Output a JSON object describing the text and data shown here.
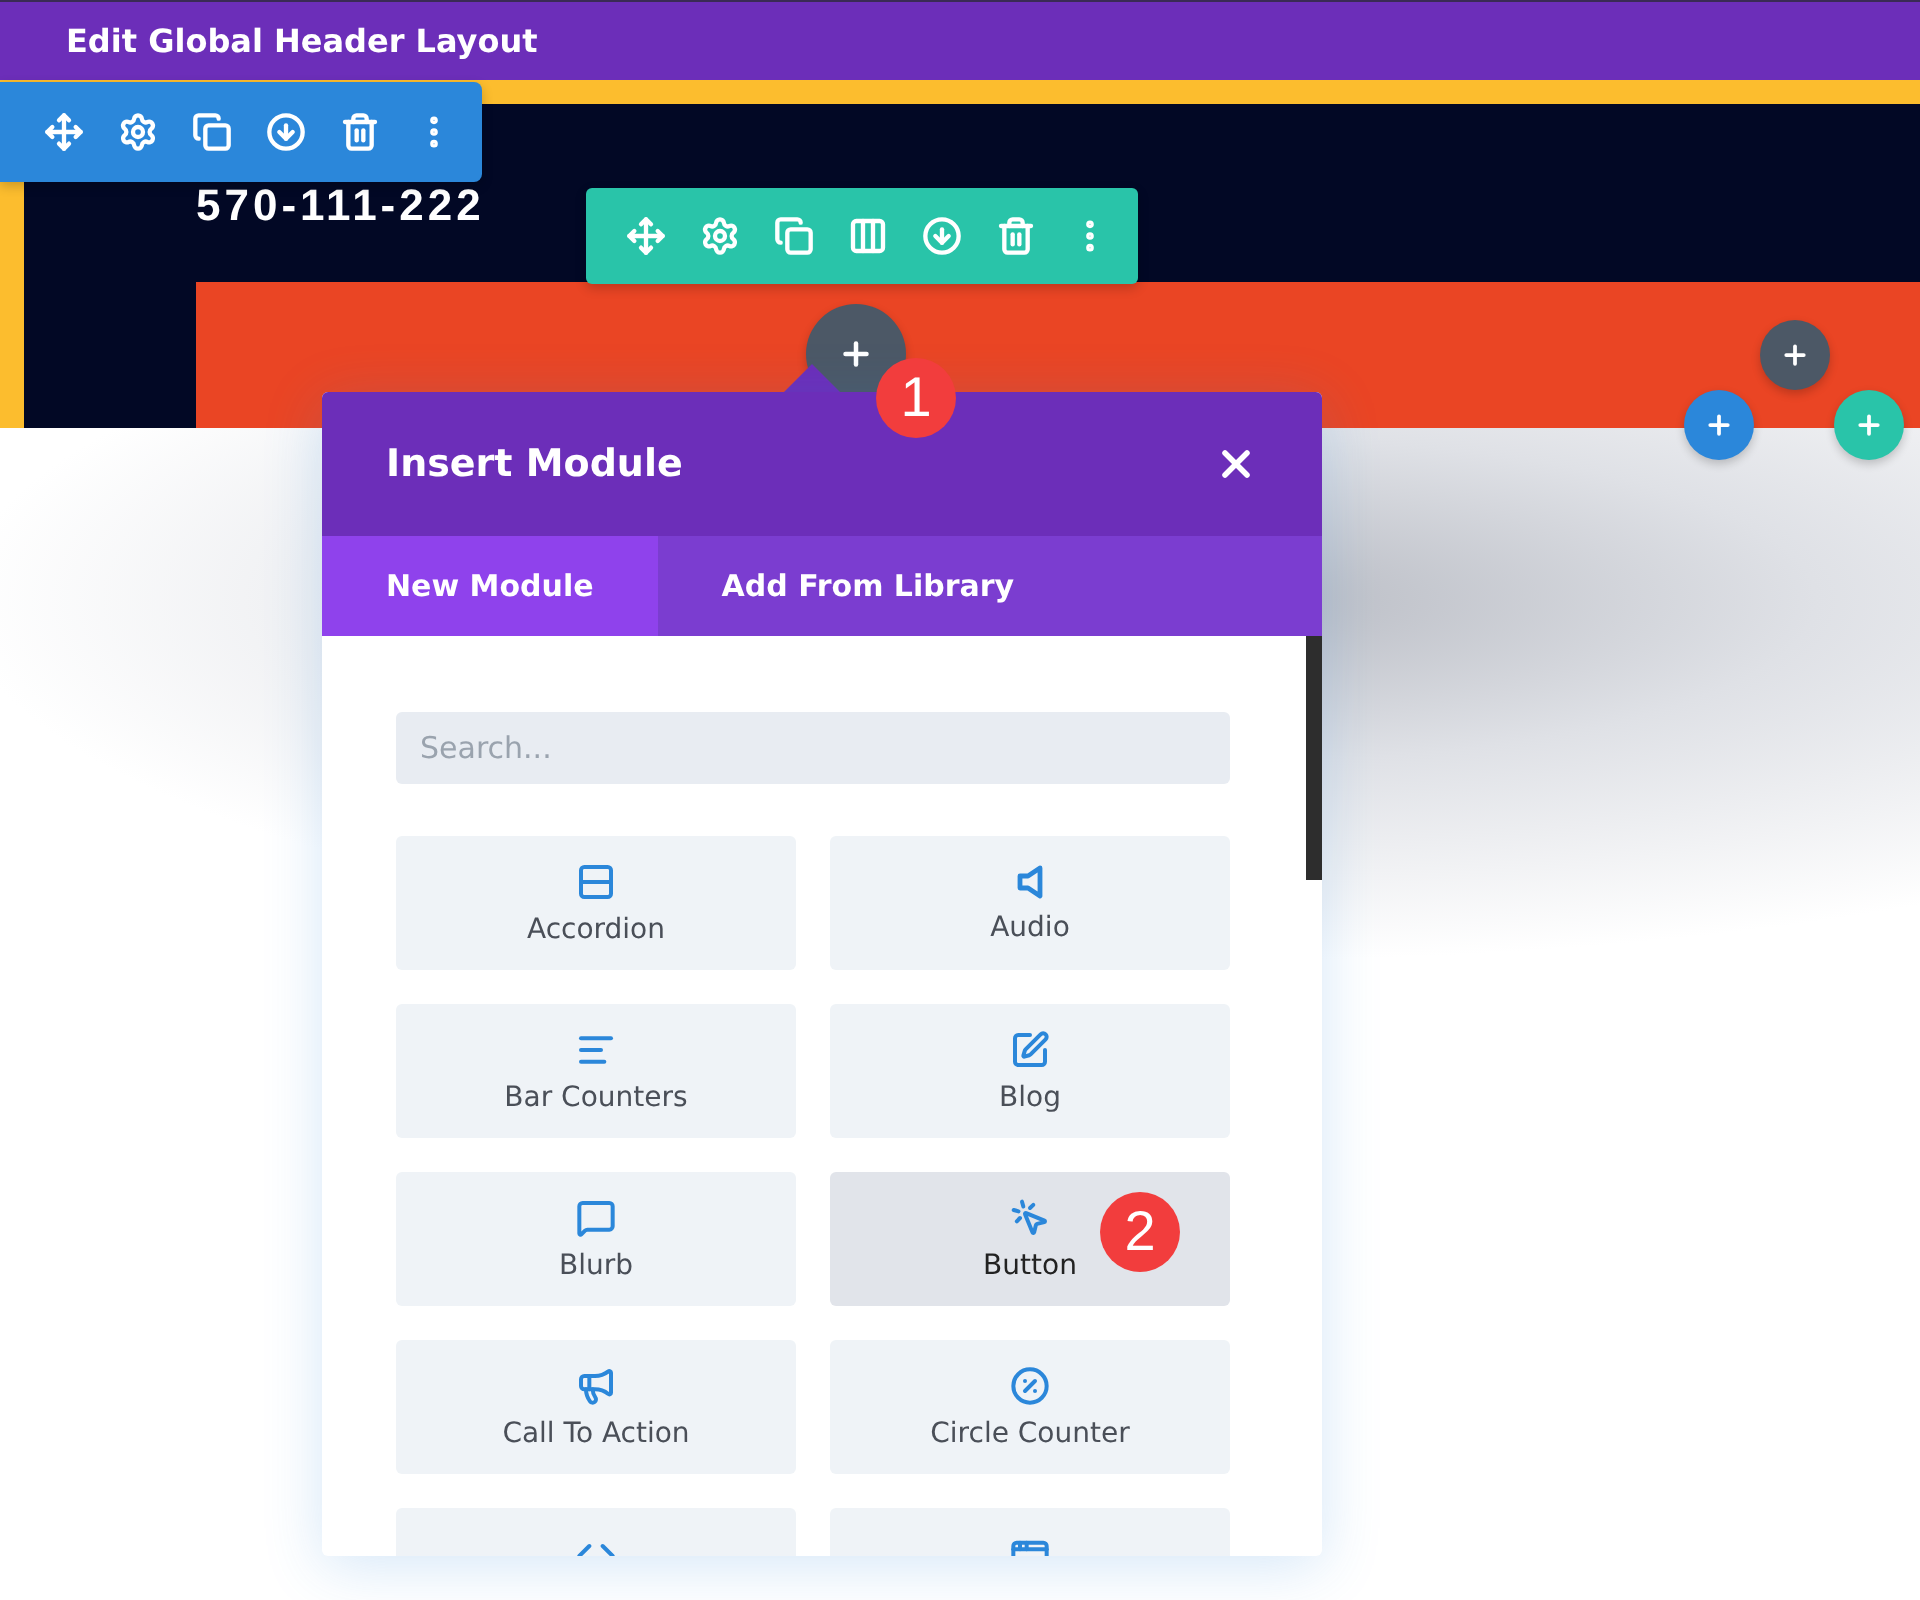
{
  "title_bar": {
    "title": "Edit Global Header Layout"
  },
  "header": {
    "phone": "570-111-222"
  },
  "add_module_button": {
    "badge": "1"
  },
  "modal": {
    "title": "Insert Module",
    "tabs": [
      {
        "label": "New Module",
        "selected": true
      },
      {
        "label": "Add From Library",
        "selected": false
      }
    ],
    "search": {
      "placeholder": "Search..."
    },
    "modules": [
      {
        "label": "Accordion",
        "selected": false
      },
      {
        "label": "Audio",
        "selected": false
      },
      {
        "label": "Bar Counters",
        "selected": false
      },
      {
        "label": "Blog",
        "selected": false
      },
      {
        "label": "Blurb",
        "selected": false
      },
      {
        "label": "Button",
        "selected": true,
        "badge": "2"
      },
      {
        "label": "Call To Action",
        "selected": false
      },
      {
        "label": "Circle Counter",
        "selected": false
      }
    ]
  }
}
